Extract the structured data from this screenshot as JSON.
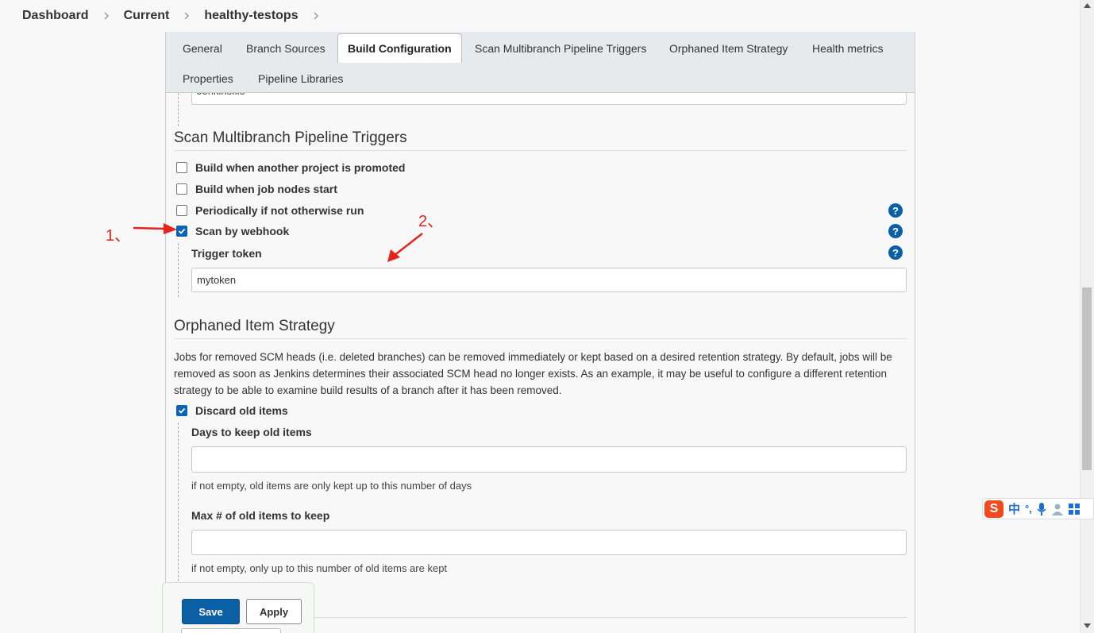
{
  "breadcrumb": [
    "Dashboard",
    "Current",
    "healthy-testops"
  ],
  "tabs": [
    {
      "label": "General",
      "active": false
    },
    {
      "label": "Branch Sources",
      "active": false
    },
    {
      "label": "Build Configuration",
      "active": true
    },
    {
      "label": "Scan Multibranch Pipeline Triggers",
      "active": false
    },
    {
      "label": "Orphaned Item Strategy",
      "active": false
    },
    {
      "label": "Health metrics",
      "active": false
    },
    {
      "label": "Properties",
      "active": false
    },
    {
      "label": "Pipeline Libraries",
      "active": false
    }
  ],
  "script_path_value": "Jenkinsfile",
  "triggers": {
    "title": "Scan Multibranch Pipeline Triggers",
    "options": [
      {
        "label": "Build when another project is promoted",
        "checked": false
      },
      {
        "label": "Build when job nodes start",
        "checked": false
      },
      {
        "label": "Periodically if not otherwise run",
        "checked": false
      },
      {
        "label": "Scan by webhook",
        "checked": true
      }
    ],
    "token_label": "Trigger token",
    "token_value": "mytoken"
  },
  "annotations": {
    "one": "1、",
    "two": "2、"
  },
  "orphaned": {
    "title": "Orphaned Item Strategy",
    "description": "Jobs for removed SCM heads (i.e. deleted branches) can be removed immediately or kept based on a desired retention strategy. By default, jobs will be removed as soon as Jenkins determines their associated SCM head no longer exists. As an example, it may be useful to configure a different retention strategy to be able to examine build results of a branch after it has been removed.",
    "discard_label": "Discard old items",
    "discard_checked": true,
    "days_label": "Days to keep old items",
    "days_value": "",
    "days_hint": "if not empty, old items are only kept up to this number of days",
    "max_label": "Max # of old items to keep",
    "max_value": "",
    "max_hint": "if not empty, only up to this number of old items are kept"
  },
  "buttons": {
    "save": "Save",
    "apply": "Apply"
  },
  "ime": {
    "logo": "S",
    "lang": "中",
    "punct": "°,"
  },
  "colors": {
    "primary": "#0b5fa5",
    "annotation": "#e5231b",
    "checkbox": "#0b62b8"
  }
}
